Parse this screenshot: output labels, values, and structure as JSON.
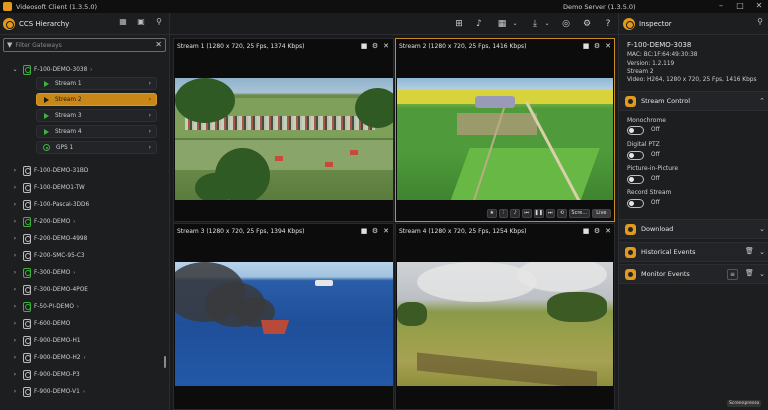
{
  "window": {
    "title": "Videosoft Client (1.3.5.0)",
    "server": "Demo Server  (1.3.5.0)"
  },
  "colors": {
    "accent": "#e39a1c",
    "selected": "#c98718",
    "online": "#3ab53a",
    "background": "#1a1b1d"
  },
  "hierarchy": {
    "title": "CCS Hierarchy",
    "filter_placeholder": "Filter Gateways",
    "expanded_device": "F-100-DEMO-3038",
    "streams": [
      {
        "label": "Stream 1",
        "selected": false
      },
      {
        "label": "Stream 2",
        "selected": true
      },
      {
        "label": "Stream 3",
        "selected": false
      },
      {
        "label": "Stream 4",
        "selected": false
      }
    ],
    "gps_label": "GPS 1",
    "devices": [
      {
        "label": "F-100-DEMO-31BD",
        "online": false,
        "has_chevron": false
      },
      {
        "label": "F-100-DEMO1-TW",
        "online": false,
        "has_chevron": false
      },
      {
        "label": "F-100-Pascal-3DD6",
        "online": false,
        "has_chevron": false
      },
      {
        "label": "F-200-DEMO",
        "online": true,
        "has_chevron": true
      },
      {
        "label": "F-200-DEMO-4998",
        "online": false,
        "has_chevron": false
      },
      {
        "label": "F-200-SMC-95-C3",
        "online": false,
        "has_chevron": false
      },
      {
        "label": "F-300-DEMO",
        "online": true,
        "has_chevron": true
      },
      {
        "label": "F-300-DEMO-4POE",
        "online": false,
        "has_chevron": false
      },
      {
        "label": "F-50-PI-DEMO",
        "online": true,
        "has_chevron": true
      },
      {
        "label": "F-600-DEMO",
        "online": false,
        "has_chevron": false
      },
      {
        "label": "F-900-DEMO-H1",
        "online": false,
        "has_chevron": false
      },
      {
        "label": "F-900-DEMO-H2",
        "online": false,
        "has_chevron": true
      },
      {
        "label": "F-900-DEMO-P3",
        "online": false,
        "has_chevron": false
      },
      {
        "label": "F-900-DEMO-V1",
        "online": false,
        "has_chevron": true
      }
    ]
  },
  "tiles": [
    {
      "caption": "Stream 1 (1280 x 720, 25 Fps, 1374 Kbps)"
    },
    {
      "caption": "Stream 2 (1280 x 720, 25 Fps, 1416 Kbps)"
    },
    {
      "caption": "Stream 3 (1280 x 720, 25 Fps, 1394 Kbps)"
    },
    {
      "caption": "Stream 4 (1280 x 720, 25 Fps, 1254 Kbps)"
    }
  ],
  "player": {
    "scr_label": "Scre...",
    "live_label": "Live"
  },
  "inspector": {
    "title": "Inspector",
    "device": "F-100-DEMO-3038",
    "mac": "MAC: BC:1F:64:49:30:38",
    "version": "Version: 1.2.119",
    "stream": "Stream 2",
    "video": "Video: H264, 1280 x 720, 25 Fps, 1416 Kbps",
    "stream_control_title": "Stream Control",
    "toggles": [
      {
        "label": "Monochrome",
        "value": "Off"
      },
      {
        "label": "Digital PTZ",
        "value": "Off"
      },
      {
        "label": "Picture-in-Picture",
        "value": "Off"
      },
      {
        "label": "Record Stream",
        "value": "Off"
      }
    ],
    "download_title": "Download",
    "historical_title": "Historical Events",
    "monitor_title": "Monitor Events"
  },
  "watermark": "Screenpresso"
}
